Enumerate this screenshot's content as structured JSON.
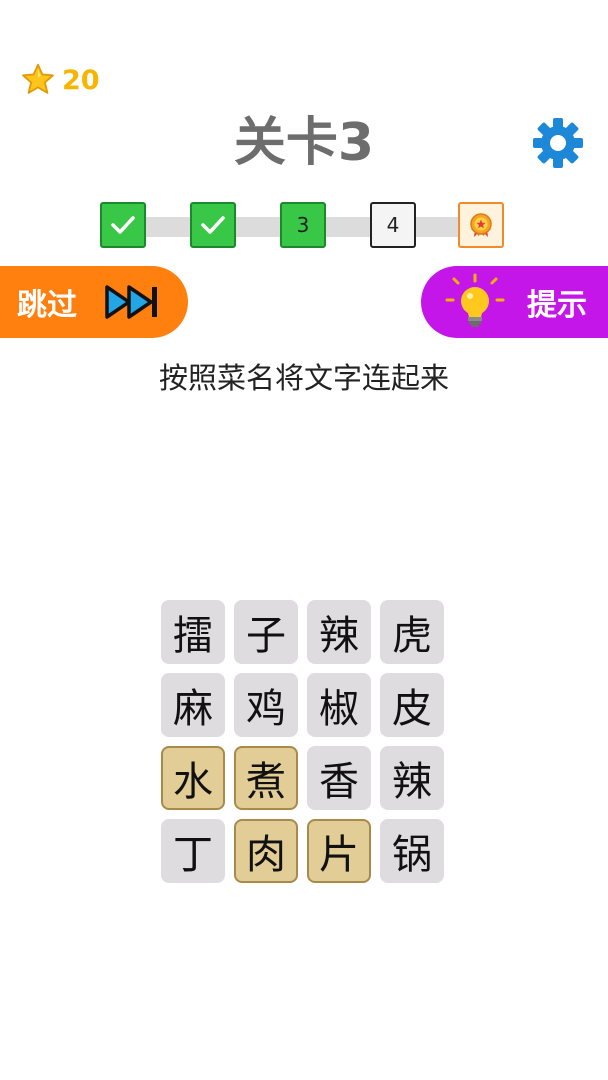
{
  "header": {
    "coins": "20",
    "title": "关卡3"
  },
  "progress": {
    "steps": [
      {
        "state": "done",
        "label": ""
      },
      {
        "state": "done",
        "label": ""
      },
      {
        "state": "current",
        "label": "3"
      },
      {
        "state": "pending",
        "label": "4"
      },
      {
        "state": "reward",
        "label": ""
      }
    ]
  },
  "buttons": {
    "skip_label": "跳过",
    "hint_label": "提示"
  },
  "instruction": "按照菜名将文字连起来",
  "grid": {
    "rows": [
      [
        {
          "char": "擂",
          "selected": false
        },
        {
          "char": "子",
          "selected": false
        },
        {
          "char": "辣",
          "selected": false
        },
        {
          "char": "虎",
          "selected": false
        }
      ],
      [
        {
          "char": "麻",
          "selected": false
        },
        {
          "char": "鸡",
          "selected": false
        },
        {
          "char": "椒",
          "selected": false
        },
        {
          "char": "皮",
          "selected": false
        }
      ],
      [
        {
          "char": "水",
          "selected": true
        },
        {
          "char": "煮",
          "selected": true
        },
        {
          "char": "香",
          "selected": false
        },
        {
          "char": "辣",
          "selected": false
        }
      ],
      [
        {
          "char": "丁",
          "selected": false
        },
        {
          "char": "肉",
          "selected": true
        },
        {
          "char": "片",
          "selected": true
        },
        {
          "char": "锅",
          "selected": false
        }
      ]
    ]
  },
  "colors": {
    "coin": "#f7b500",
    "title": "#6d6d6d",
    "settings": "#1e88d8",
    "step_done": "#39c748",
    "skip": "#ff7f0f",
    "hint": "#c516ea",
    "tile": "#dedcdf",
    "tile_selected": "#e2cd97"
  },
  "icons": {
    "coin": "star-icon",
    "settings": "gear-icon",
    "skip": "fast-forward-icon",
    "hint": "lightbulb-icon",
    "reward": "medal-icon"
  }
}
